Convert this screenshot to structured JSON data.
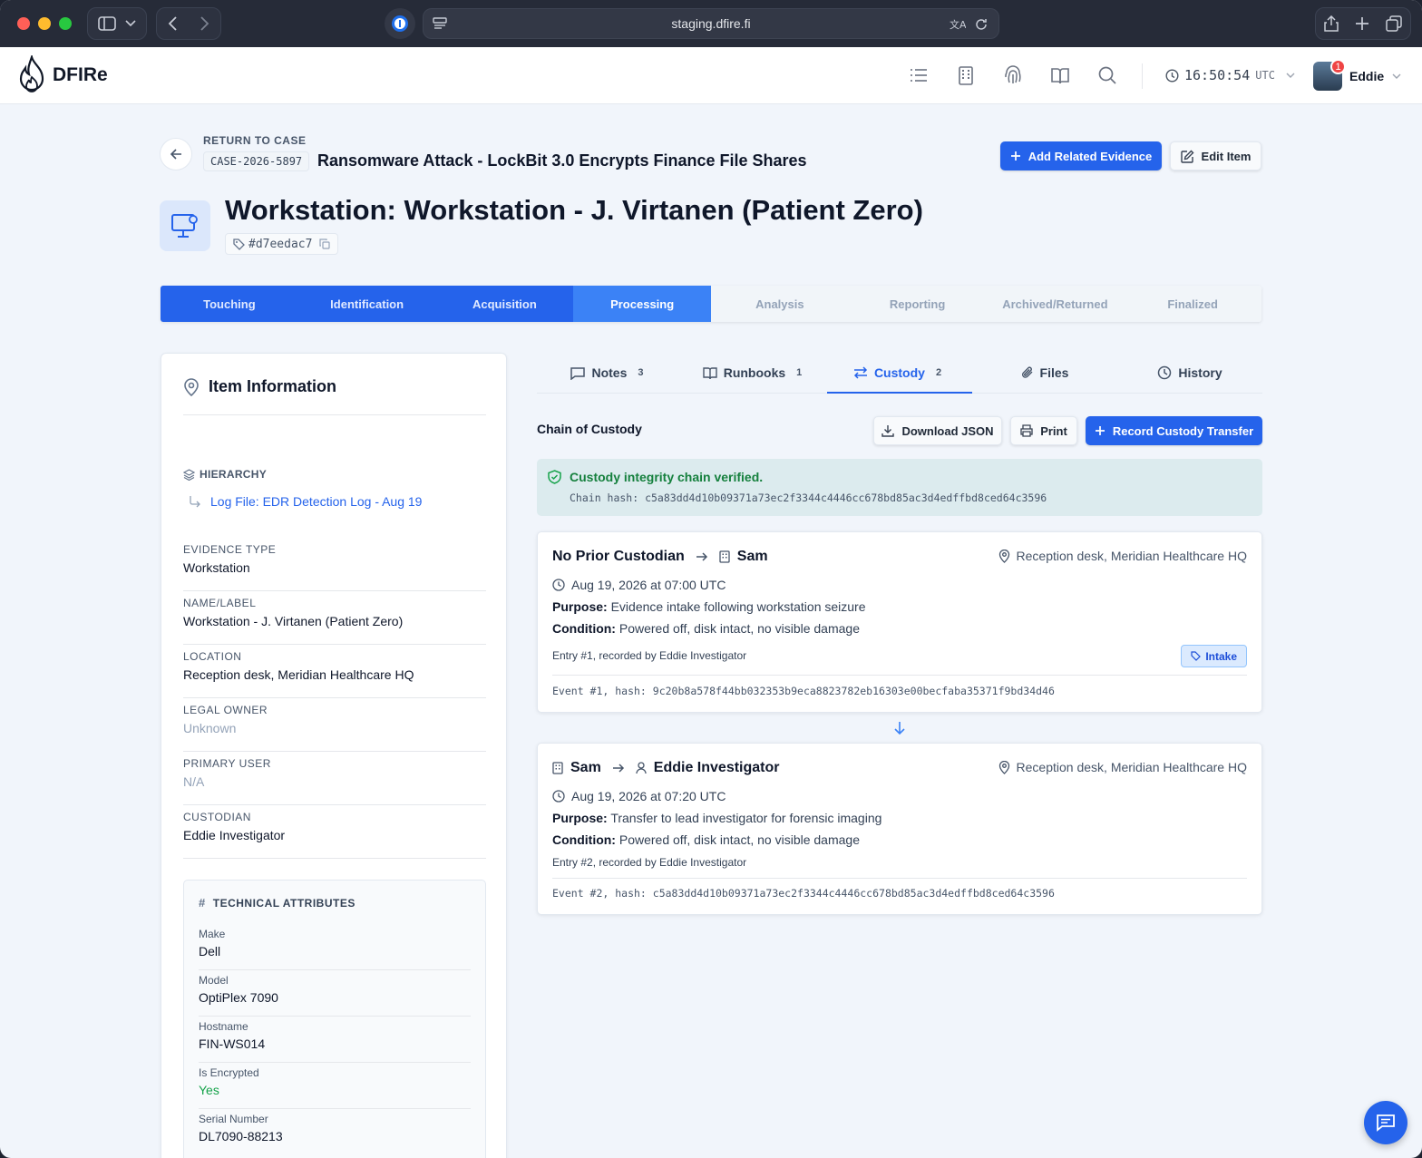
{
  "browser": {
    "url": "staging.dfire.fi"
  },
  "app": {
    "logo_text": "DFIRe",
    "clock": "16:50:54",
    "clock_tz": "UTC",
    "notification_count": "1",
    "user_name": "Eddie"
  },
  "page": {
    "return_label": "RETURN TO CASE",
    "case_id": "CASE-2026-5897",
    "case_title": "Ransomware Attack - LockBit 3.0 Encrypts Finance File Shares",
    "add_related_label": "Add Related Evidence",
    "edit_item_label": "Edit Item",
    "item_title": "Workstation: Workstation - J. Virtanen (Patient Zero)",
    "item_hash": "#d7eedac7"
  },
  "stepper": [
    {
      "label": "Touching",
      "state": "done"
    },
    {
      "label": "Identification",
      "state": "done"
    },
    {
      "label": "Acquisition",
      "state": "done"
    },
    {
      "label": "Processing",
      "state": "current"
    },
    {
      "label": "Analysis",
      "state": "todo"
    },
    {
      "label": "Reporting",
      "state": "todo"
    },
    {
      "label": "Archived/Returned",
      "state": "todo"
    },
    {
      "label": "Finalized",
      "state": "todo"
    }
  ],
  "item_info": {
    "title": "Item Information",
    "hierarchy_label": "HIERARCHY",
    "hierarchy_link": "Log File: EDR Detection Log - Aug 19",
    "fields": [
      {
        "label": "EVIDENCE TYPE",
        "value": "Workstation"
      },
      {
        "label": "NAME/LABEL",
        "value": "Workstation - J. Virtanen (Patient Zero)"
      },
      {
        "label": "LOCATION",
        "value": "Reception desk, Meridian Healthcare HQ"
      },
      {
        "label": "LEGAL OWNER",
        "value": "Unknown"
      },
      {
        "label": "PRIMARY USER",
        "value": "N/A"
      },
      {
        "label": "CUSTODIAN",
        "value": "Eddie Investigator"
      }
    ],
    "tech_title": "TECHNICAL ATTRIBUTES",
    "tech": [
      {
        "label": "Make",
        "value": "Dell"
      },
      {
        "label": "Model",
        "value": "OptiPlex 7090"
      },
      {
        "label": "Hostname",
        "value": "FIN-WS014"
      },
      {
        "label": "Is Encrypted",
        "value": "Yes"
      },
      {
        "label": "Serial Number",
        "value": "DL7090-88213"
      }
    ]
  },
  "tabs": [
    {
      "label": "Notes",
      "count": "3"
    },
    {
      "label": "Runbooks",
      "count": "1"
    },
    {
      "label": "Custody",
      "count": "2"
    },
    {
      "label": "Files",
      "count": ""
    },
    {
      "label": "History",
      "count": ""
    }
  ],
  "custody": {
    "title": "Chain of Custody",
    "download_label": "Download JSON",
    "print_label": "Print",
    "record_label": "Record Custody Transfer",
    "verified_text": "Custody integrity chain verified.",
    "chain_hash": "Chain hash: c5a83dd4d10b09371a73ec2f3344c4446cc678bd85ac3d4edffbd8ced64c3596",
    "entries": [
      {
        "from": "No Prior Custodian",
        "to": "Sam",
        "location": "Reception desk, Meridian Healthcare HQ",
        "date": "Aug 19, 2026 at 07:00 UTC",
        "purpose_label": "Purpose:",
        "purpose": "Evidence intake following workstation seizure",
        "condition_label": "Condition:",
        "condition": "Powered off, disk intact, no visible damage",
        "recorded": "Entry #1, recorded by Eddie Investigator",
        "tag": "Intake",
        "hash": "Event #1, hash: 9c20b8a578f44bb032353b9eca8823782eb16303e00becfaba35371f9bd34d46"
      },
      {
        "from": "Sam",
        "to": "Eddie Investigator",
        "location": "Reception desk, Meridian Healthcare HQ",
        "date": "Aug 19, 2026 at 07:20 UTC",
        "purpose_label": "Purpose:",
        "purpose": "Transfer to lead investigator for forensic imaging",
        "condition_label": "Condition:",
        "condition": "Powered off, disk intact, no visible damage",
        "recorded": "Entry #2, recorded by Eddie Investigator",
        "hash": "Event #2, hash: c5a83dd4d10b09371a73ec2f3344c4446cc678bd85ac3d4edffbd8ced64c3596"
      }
    ]
  },
  "colors": {
    "accent": "#2563eb",
    "success": "#16a34a"
  }
}
